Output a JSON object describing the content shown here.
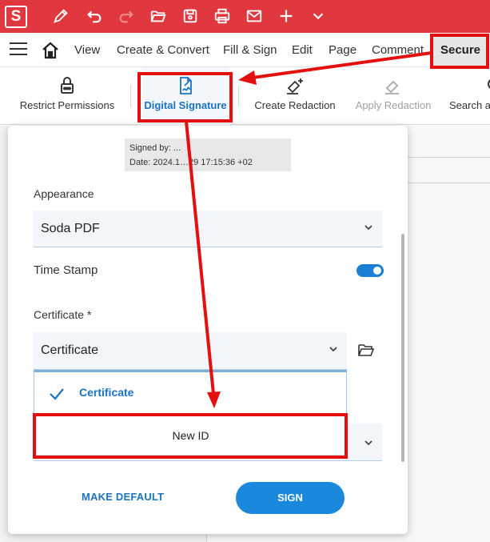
{
  "titlebar": {
    "logo_letter": "S",
    "icons": [
      "pen-icon",
      "undo-icon",
      "redo-icon",
      "open-folder-icon",
      "save-icon",
      "print-icon",
      "mail-icon",
      "plus-icon",
      "chevron-down-icon"
    ]
  },
  "menu": {
    "items": [
      "View",
      "Create & Convert",
      "Fill & Sign",
      "Edit",
      "Page",
      "Comment",
      "Secure"
    ],
    "active": "Secure"
  },
  "ribbon": {
    "restrict_permissions": "Restrict Permissions",
    "digital_signature": "Digital Signature",
    "create_redaction": "Create Redaction",
    "apply_redaction": "Apply Redaction",
    "search": "Search a"
  },
  "panel": {
    "signed_by": "Signed by: ...",
    "date": "Date: 2024.1…29 17:15:36 +02",
    "appearance_label": "Appearance",
    "appearance_value": "Soda PDF",
    "timestamp_label": "Time Stamp",
    "timestamp_on": true,
    "certificate_label": "Certificate *",
    "certificate_value": "Certificate",
    "dropdown_options": [
      "Certificate",
      "New ID"
    ],
    "selected_option": "Certificate",
    "make_default": "MAKE DEFAULT",
    "sign": "SIGN"
  },
  "colors": {
    "titlebar": "#e0383e",
    "accent": "#1a73c4",
    "annotation": "#e40f0f"
  }
}
